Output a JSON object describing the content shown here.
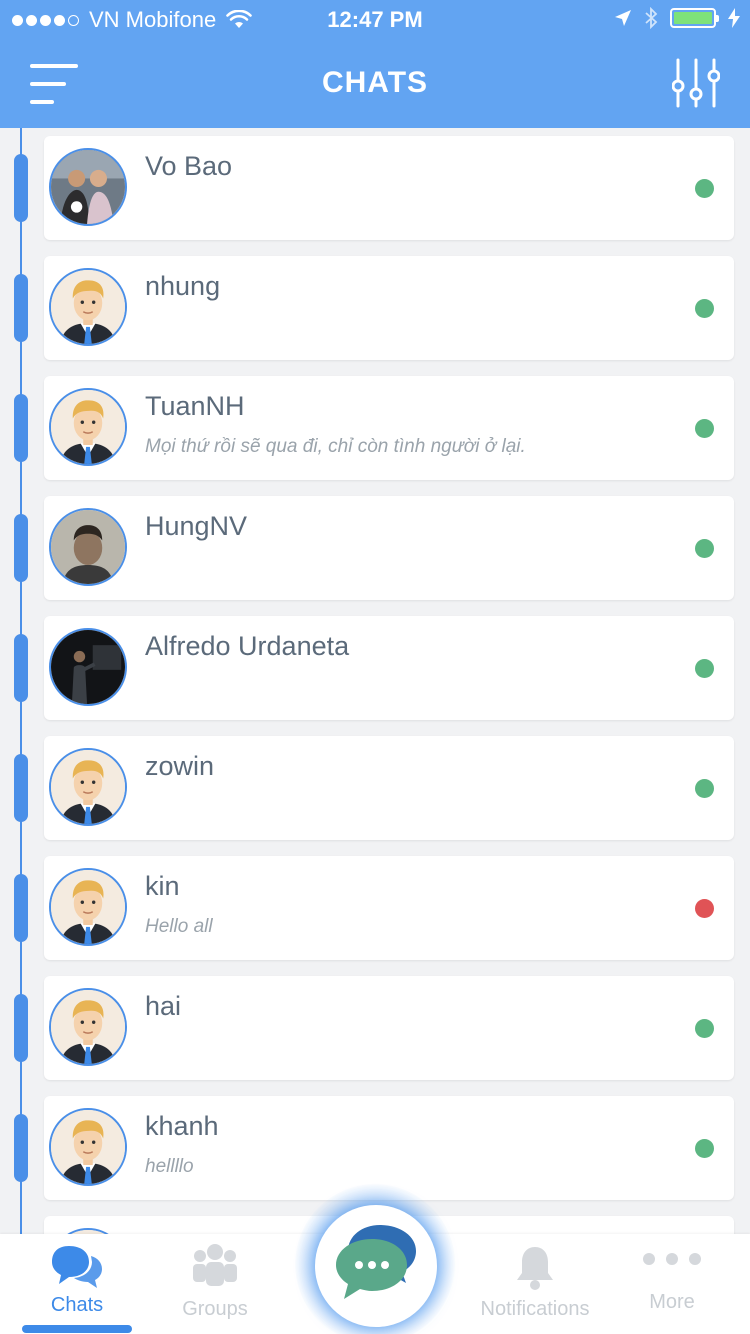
{
  "status_bar": {
    "carrier": "VN Mobifone",
    "time": "12:47 PM",
    "signal_dots_filled": 4,
    "signal_dots_total": 5,
    "battery_color": "#7ee27a"
  },
  "header": {
    "title": "CHATS",
    "left_icon": "hamburger-menu-icon",
    "right_icon": "sliders-filter-icon"
  },
  "colors": {
    "accent": "#62a4f2",
    "timeline": "#4a8fe8",
    "online": "#5cb682",
    "busy": "#e05356"
  },
  "chats": [
    {
      "name": "Vo Bao",
      "message": "",
      "status": "online",
      "avatar": "photo-couple"
    },
    {
      "name": "nhung",
      "message": "",
      "status": "online",
      "avatar": "default-man"
    },
    {
      "name": "TuanNH",
      "message": "Mọi thứ rồi sẽ qua đi, chỉ còn tình người ở lại.",
      "status": "online",
      "avatar": "default-man"
    },
    {
      "name": "HungNV",
      "message": "",
      "status": "online",
      "avatar": "photo-man"
    },
    {
      "name": "Alfredo Urdaneta",
      "message": "",
      "status": "online",
      "avatar": "photo-speaker"
    },
    {
      "name": "zowin",
      "message": "",
      "status": "online",
      "avatar": "default-man"
    },
    {
      "name": "kin",
      "message": "Hello all",
      "status": "busy",
      "avatar": "default-man"
    },
    {
      "name": "hai",
      "message": "",
      "status": "online",
      "avatar": "default-man"
    },
    {
      "name": "khanh",
      "message": "hellllo",
      "status": "online",
      "avatar": "default-man"
    }
  ],
  "tabs": [
    {
      "label": "Chats",
      "icon": "chat-bubbles-icon",
      "active": true
    },
    {
      "label": "Groups",
      "icon": "group-people-icon",
      "active": false
    },
    {
      "label": "",
      "icon": "new-chat-bubble-icon",
      "active": false
    },
    {
      "label": "Notifications",
      "icon": "bell-icon",
      "active": false
    },
    {
      "label": "More",
      "icon": "more-dots-icon",
      "active": false
    }
  ]
}
